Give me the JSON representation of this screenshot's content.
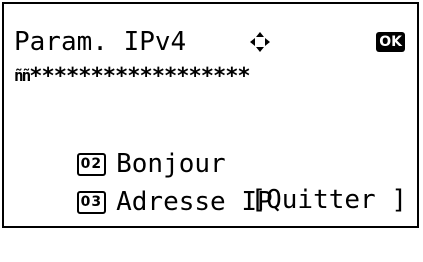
{
  "screen": {
    "title": "Param. IPv4",
    "nav_icon": "up-down-left-right-arrows-icon",
    "ok_label": "OK",
    "separator_prefix": "ññ",
    "separator": "******************"
  },
  "menu": {
    "items": [
      {
        "number": "02",
        "label": "Bonjour"
      },
      {
        "number": "03",
        "label": "Adresse IP"
      }
    ]
  },
  "softkey": {
    "exit_label": "[Quitter ]"
  }
}
